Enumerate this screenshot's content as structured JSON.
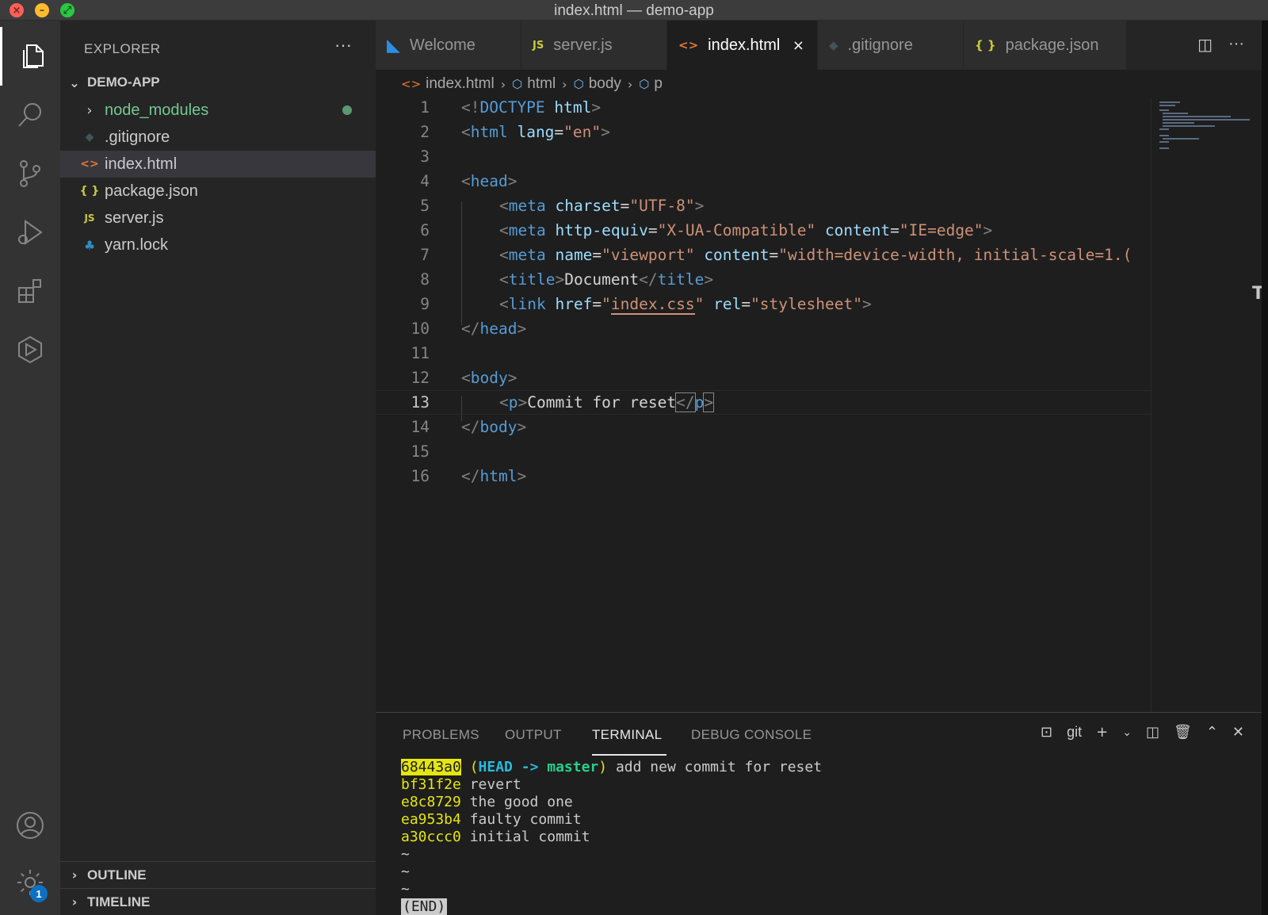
{
  "window": {
    "title": "index.html — demo-app"
  },
  "activity_bar": {
    "items": [
      "explorer-icon",
      "search-icon",
      "source-control-icon",
      "run-debug-icon",
      "extensions-icon",
      "remote-icon"
    ],
    "bottom": [
      "account-icon",
      "settings-icon"
    ],
    "settings_badge": "1"
  },
  "sidebar": {
    "header": "EXPLORER",
    "more": "···",
    "folder": "DEMO-APP",
    "items": [
      {
        "label": "node_modules",
        "icon": "›",
        "color": "#73c991",
        "modified": true
      },
      {
        "label": ".gitignore",
        "icon": "◆",
        "color": "#cccccc"
      },
      {
        "label": "index.html",
        "icon": "<>",
        "color": "#cccccc",
        "selected": true
      },
      {
        "label": "package.json",
        "icon": "{ }",
        "color": "#cccccc"
      },
      {
        "label": "server.js",
        "icon": "JS",
        "color": "#cccccc"
      },
      {
        "label": "yarn.lock",
        "icon": "yarn-icon",
        "color": "#cccccc"
      }
    ],
    "outline": "OUTLINE",
    "timeline": "TIMELINE"
  },
  "tabs": [
    {
      "label": "Welcome",
      "icon": "vscode-icon",
      "active": false
    },
    {
      "label": "server.js",
      "icon": "JS",
      "active": false
    },
    {
      "label": "index.html",
      "icon": "<>",
      "active": true,
      "close": "×"
    },
    {
      "label": ".gitignore",
      "icon": "◆",
      "active": false
    },
    {
      "label": "package.json",
      "icon": "{ }",
      "active": false
    }
  ],
  "breadcrumb": [
    "index.html",
    "html",
    "body",
    "p"
  ],
  "editor": {
    "current_line": 13,
    "line_numbers": [
      "1",
      "2",
      "3",
      "4",
      "5",
      "6",
      "7",
      "8",
      "9",
      "10",
      "11",
      "12",
      "13",
      "14",
      "15",
      "16"
    ],
    "l1": {
      "a": "<!",
      "b": "DOCTYPE",
      "c": " html",
      "d": ">"
    },
    "l2": {
      "a": "<",
      "b": "html",
      "c": " lang",
      "d": "=",
      "e": "\"en\"",
      "f": ">"
    },
    "l4": {
      "a": "<",
      "b": "head",
      "c": ">"
    },
    "l5": {
      "a": "<",
      "b": "meta",
      "c": " charset",
      "d": "=",
      "e": "\"UTF-8\"",
      "f": ">"
    },
    "l6": {
      "a": "<",
      "b": "meta",
      "c": " http-equiv",
      "d": "=",
      "e": "\"X-UA-Compatible\"",
      "g": " content",
      "h": "=",
      "i": "\"IE=edge\"",
      "f": ">"
    },
    "l7": {
      "a": "<",
      "b": "meta",
      "c": " name",
      "d": "=",
      "e": "\"viewport\"",
      "g": " content",
      "h": "=",
      "i": "\"width=device-width, initial-scale=1.("
    },
    "l8": {
      "a": "<",
      "b": "title",
      "c": ">",
      "d": "Document",
      "e": "</",
      "f": "title",
      "g": ">"
    },
    "l9": {
      "a": "<",
      "b": "link",
      "c": " href",
      "d": "=",
      "e1": "\"",
      "e2": "index.css",
      "e3": "\"",
      "g": " rel",
      "h": "=",
      "i": "\"stylesheet\"",
      "f": ">"
    },
    "l10": {
      "a": "</",
      "b": "head",
      "c": ">"
    },
    "l12": {
      "a": "<",
      "b": "body",
      "c": ">"
    },
    "l13": {
      "a": "<",
      "b": "p",
      "c": ">",
      "d": "Commit for reset",
      "e": "</",
      "f": "p",
      "g": ">"
    },
    "l14": {
      "a": "</",
      "b": "body",
      "c": ">"
    },
    "l16": {
      "a": "</",
      "b": "html",
      "c": ">"
    }
  },
  "panel": {
    "tabs": [
      "PROBLEMS",
      "OUTPUT",
      "TERMINAL",
      "DEBUG CONSOLE"
    ],
    "active_tab": "TERMINAL",
    "shell": "git",
    "terminal": [
      {
        "hash": "68443a0",
        "refs_open": "(",
        "head": "HEAD -> ",
        "branch": "master",
        "refs_close": ")",
        "msg": " add new commit for reset"
      },
      {
        "hash": "bf31f2e",
        "msg": " revert"
      },
      {
        "hash": "e8c8729",
        "msg": " the good one"
      },
      {
        "hash": "ea953b4",
        "msg": " faulty commit"
      },
      {
        "hash": "a30ccc0",
        "msg": " initial commit"
      }
    ],
    "tildes": [
      "~",
      "~",
      "~"
    ],
    "end_marker": "(END)"
  },
  "colors": {
    "accent": "#0e70c0",
    "modified_green": "#73c991",
    "hash_yellow": "#e5e510",
    "head_cyan": "#29b8db",
    "branch_green": "#23d18b"
  }
}
